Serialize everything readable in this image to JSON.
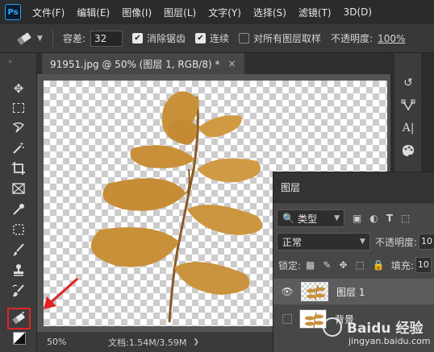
{
  "app": {
    "logo_text": "Ps"
  },
  "menu": {
    "items": [
      "文件(F)",
      "编辑(E)",
      "图像(I)",
      "图层(L)",
      "文字(Y)",
      "选择(S)",
      "滤镜(T)",
      "3D(D)"
    ]
  },
  "options": {
    "tolerance_label": "容差:",
    "tolerance_value": "32",
    "antialias_label": "消除锯齿",
    "antialias_checked": true,
    "contiguous_label": "连续",
    "contiguous_checked": true,
    "sample_all_label": "对所有图层取样",
    "sample_all_checked": false,
    "opacity_label": "不透明度:",
    "opacity_value": "100%"
  },
  "document": {
    "tab_title": "91951.jpg @ 50% (图层 1, RGB/8) *",
    "close_glyph": "×"
  },
  "status": {
    "zoom": "50%",
    "doc_info": "文档:1.54M/3.59M"
  },
  "layers_panel": {
    "title": "图层",
    "filter_kind": "类型",
    "blend_mode": "正常",
    "opacity_label": "不透明度:",
    "opacity_value": "10",
    "lock_label": "锁定:",
    "fill_label": "填充:",
    "fill_value": "10",
    "layers": [
      {
        "name": "图层 1",
        "visible": true,
        "active": true
      },
      {
        "name": "背景",
        "visible": false,
        "active": false
      }
    ]
  },
  "watermark": {
    "title": "Baidu 经验",
    "url": "jingyan.baidu.com"
  },
  "colors": {
    "accent_red": "#e02424",
    "leaf": "#c9923a",
    "stem": "#8a5a24"
  },
  "icons": {
    "toolbar": [
      "move-icon",
      "marquee-icon",
      "lasso-icon",
      "magic-wand-icon",
      "crop-icon",
      "frame-icon",
      "eyedropper-icon",
      "healing-brush-icon",
      "brush-icon",
      "stamp-icon",
      "history-brush-icon",
      "magic-eraser-icon"
    ],
    "right_strip": [
      "history-icon",
      "paths-icon",
      "character-icon",
      "swatches-icon"
    ]
  }
}
